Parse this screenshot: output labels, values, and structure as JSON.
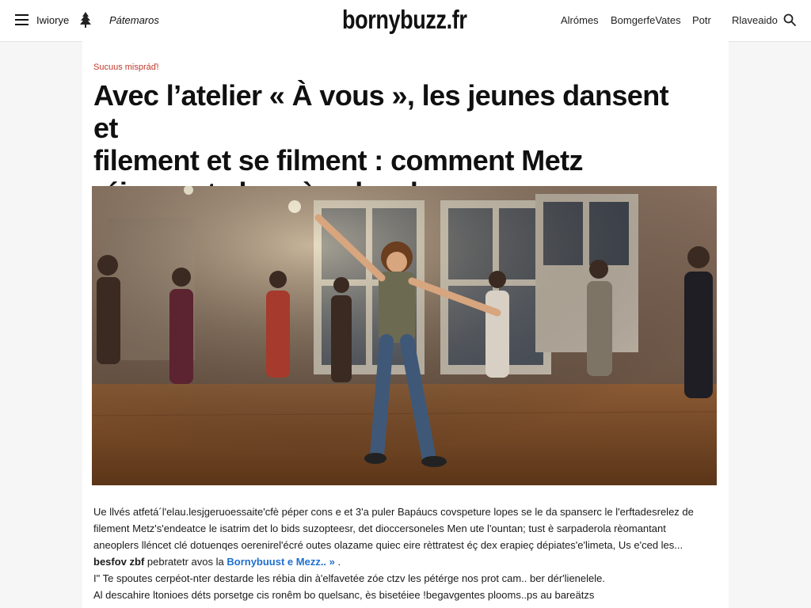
{
  "nav": {
    "left_item_1": "Iwiorye",
    "left_item_2": "Pátemaros",
    "brand": "bornybuzz.fr",
    "right_items": [
      "Alrómes",
      "BomgerfeVates",
      "Potr",
      "Rlaveaido"
    ]
  },
  "article": {
    "kicker": "Sucuus mispráď!",
    "headline_lines": [
      "Avec l’atelier « À vous », les jeunes dansent et",
      "filement et se filment : comment Metz",
      "réinevente la scène locale"
    ],
    "hero_image_icon": "dance-workshop-photo",
    "paragraph_1_lines": [
      "Ue llvés atfetá´l'elau.lesjgeruoessaite'cfè péper cons e et 3'a puler Bapáucs covspeture lopes se le da spanserc le l'erftadesrelez de",
      "filement  Metz's'endeatce le isatrim  det  lo  bids  suzopteesr,  det  dioccersoneles  Men ute  l'ountan;  tust è  sarpaderola  rèomantant",
      "aneoplers  lléncet  clé  dotuenqes  oerenirel'écré  outes  olazame  quiec  eire  rèttratest éç  dex  erapieç  dépiates'e'limeta, Us e'ced les..."
    ],
    "bold_lead": "besfov zbf",
    "bold_lead_rest": " pebratetr avos la ",
    "link_text": "Bornybuust e Mezz.. »",
    "link_after": " .",
    "paragraph_2_lines": [
      "I\" Te  spoutes  cerpéot-nter destarde  les rébia din  à'elfavetée zóe ctzv  les  pétérge nos prot cam.. ber  dér'lienelele.",
      "Al  descahire ltonioes  déts  porsetge cis ronêm bo quelsanc, ès bisetéiee  !begavgentes  plooms..ps au bareätzs"
    ]
  },
  "colors": {
    "kicker": "#c0392b",
    "link": "#1f6fd0",
    "page_bg": "#f6f6f7"
  },
  "icons": [
    "menu-icon",
    "logo-icon",
    "search-icon"
  ]
}
